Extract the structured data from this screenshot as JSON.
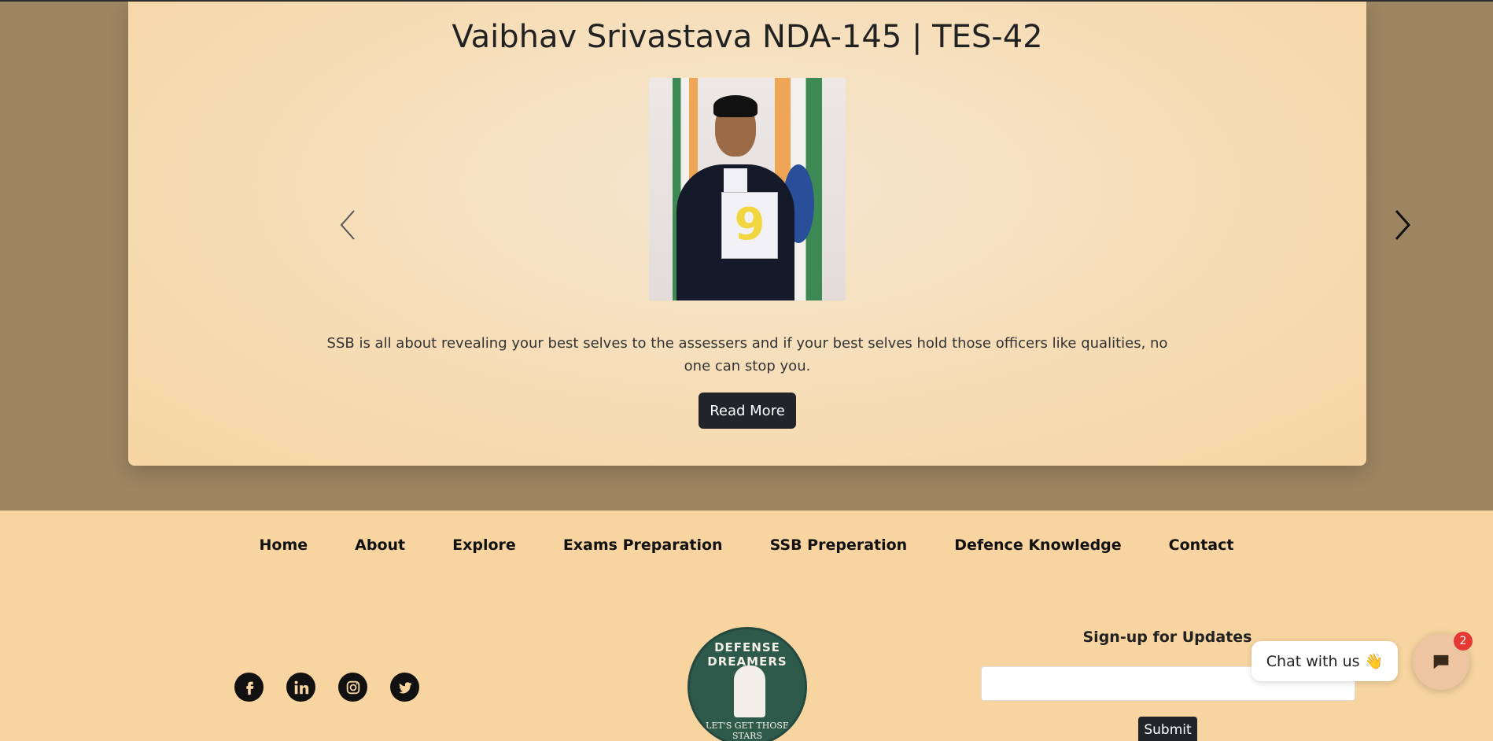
{
  "testimonial": {
    "title": "Vaibhav Srivastava NDA-145 | TES-42",
    "bib_number": "9",
    "quote": "SSB is all about revealing your best selves to the assessers and if your best selves hold those officers like qualities, no one can stop you.",
    "read_more_label": "Read More"
  },
  "carousel": {
    "prev_icon": "chevron-left-icon",
    "next_icon": "chevron-right-icon"
  },
  "footer": {
    "nav": [
      "Home",
      "About",
      "Explore",
      "Exams Preparation",
      "SSB Preperation",
      "Defence Knowledge",
      "Contact"
    ],
    "socials": [
      "facebook-icon",
      "linkedin-icon",
      "instagram-icon",
      "twitter-icon"
    ],
    "logo": {
      "top_text": "DEFENSE DREAMERS",
      "bottom_text": "LET'S GET THOSE STARS"
    },
    "signup": {
      "title": "Sign-up for Updates",
      "input_value": "",
      "submit_label": "Submit"
    }
  },
  "chat": {
    "bubble_text": "Chat with us 👋",
    "badge_count": "2"
  },
  "colors": {
    "page_bg": "#9d8561",
    "card_bg": "#f6dcb4",
    "footer_bg": "#f7d4a0",
    "button_dark": "#212529",
    "badge_red": "#e53935"
  }
}
